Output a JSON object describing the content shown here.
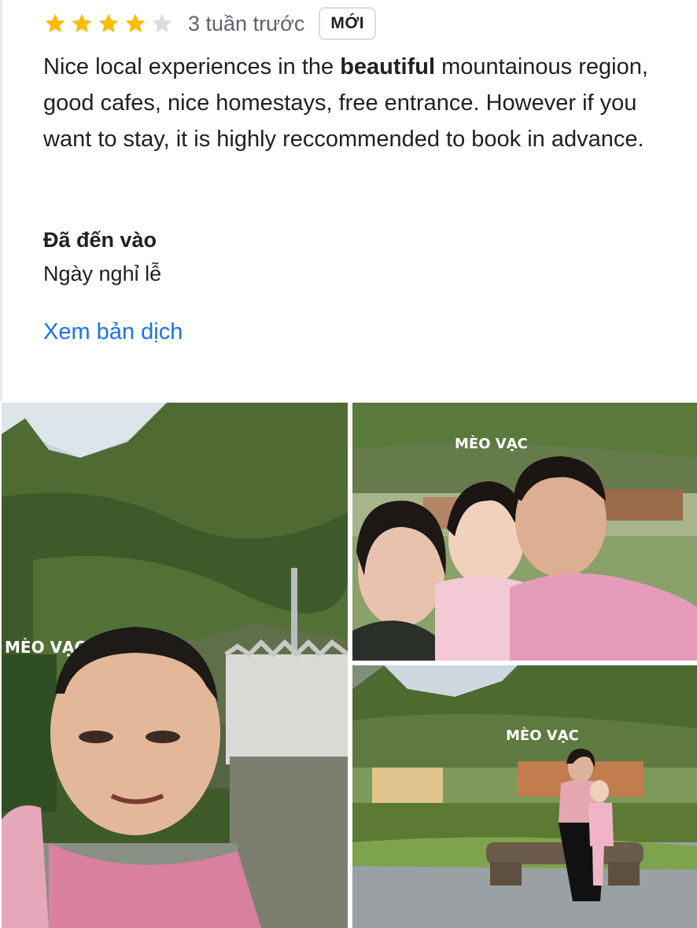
{
  "review": {
    "rating": 4,
    "max_rating": 5,
    "time_ago": "3 tuần trước",
    "badge": "MỚI",
    "text_before": "Nice local experiences in the ",
    "text_bold": "beautiful",
    "text_after": " mountainous region, good cafes, nice homestays, free entrance. However if you want to stay, it is highly reccommended to book in advance.",
    "visit_label": "Đã đến vào",
    "visit_value": "Ngày nghỉ lễ",
    "translate_link": "Xem bản dịch"
  },
  "photos": {
    "sign_text_1": "MÈO VẠC",
    "sign_text_2": "MÈO VẠC",
    "sign_text_3": "MÈO VẠC"
  },
  "colors": {
    "star_filled": "#fbbc04",
    "star_empty": "#dadce0",
    "link": "#1a73e8"
  }
}
